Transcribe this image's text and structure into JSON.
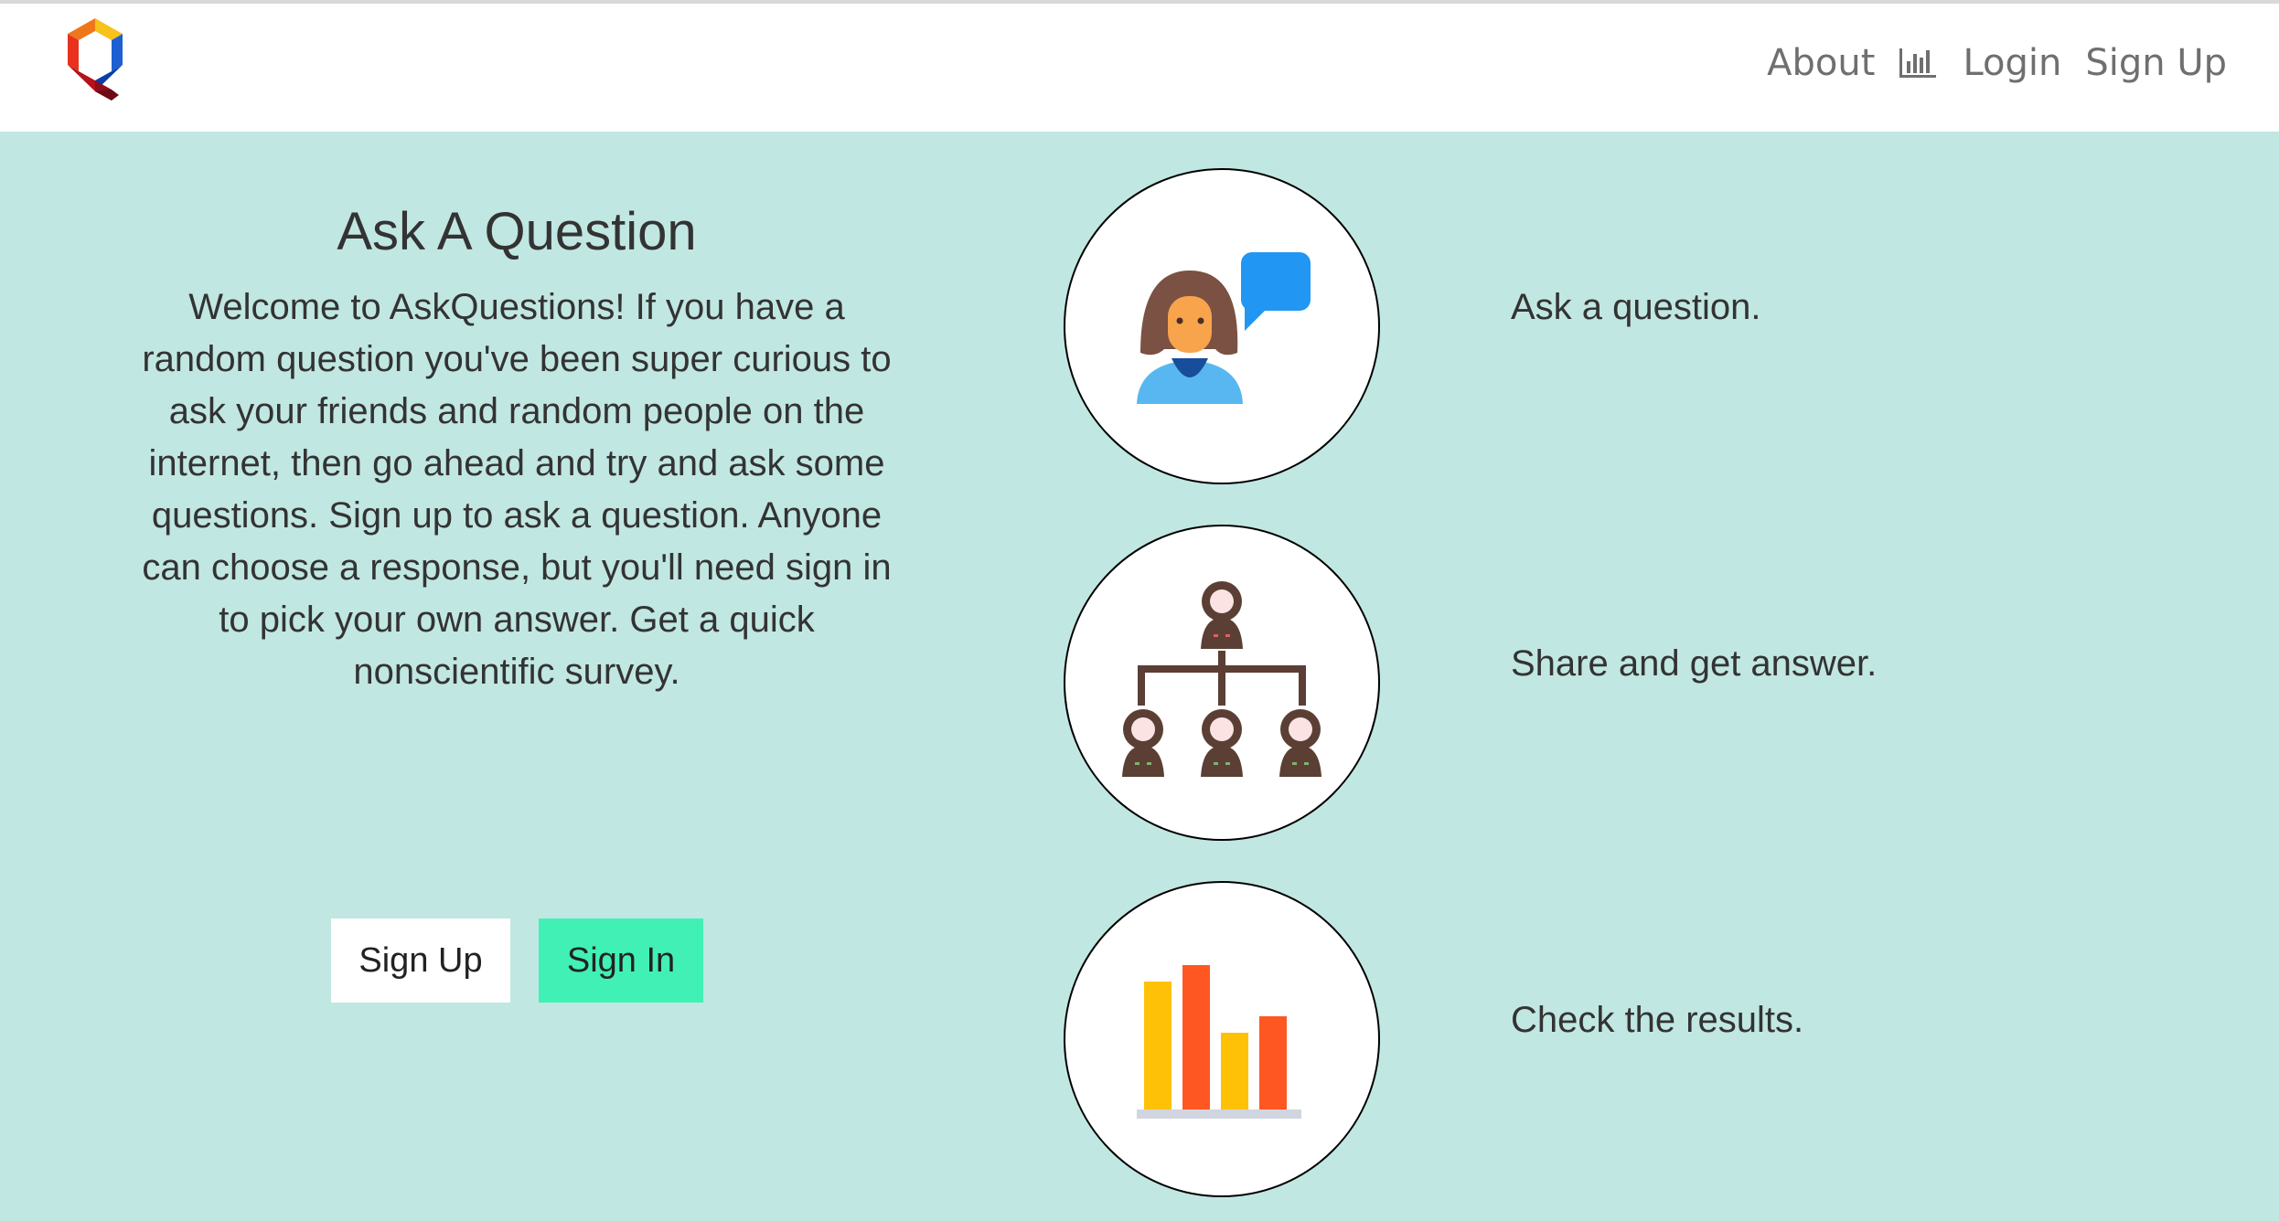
{
  "header": {
    "logo_icon": "q-cube-logo",
    "links": {
      "about": "About",
      "stats_icon": "bar-chart-icon",
      "login": "Login",
      "signup": "Sign Up"
    }
  },
  "hero": {
    "title": "Ask A Question",
    "text": "Welcome to AskQuestions! If you have a random question you've been super curious to ask your friends and random people on the internet, then go ahead and try and ask some questions. Sign up to ask a question. Anyone can choose a response, but you'll need sign in to pick your own answer. Get a quick nonscientific survey.",
    "buttons": {
      "signup": "Sign Up",
      "signin": "Sign In"
    }
  },
  "steps": [
    {
      "icon": "person-speech-icon",
      "text": "Ask a question."
    },
    {
      "icon": "hierarchy-people-icon",
      "text": "Share and get answer."
    },
    {
      "icon": "bar-chart-results-icon",
      "text": "Check the results."
    }
  ],
  "colors": {
    "background": "#c1e7e2",
    "signin_button": "#41f0b5",
    "nav_text": "#6f6f6f"
  }
}
